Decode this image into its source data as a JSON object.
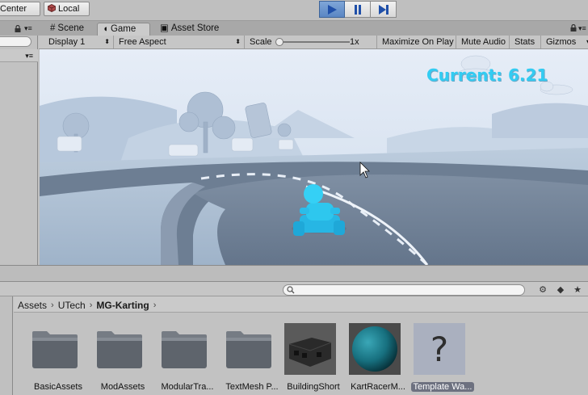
{
  "toolbar": {
    "center_label": "Center",
    "local_label": "Local"
  },
  "tabs": [
    {
      "label": "Scene",
      "icon": "grid-icon"
    },
    {
      "label": "Game",
      "icon": "pacman-icon"
    },
    {
      "label": "Asset Store",
      "icon": "store-icon"
    }
  ],
  "game_header": {
    "display": "Display 1",
    "aspect": "Free Aspect",
    "scale_label": "Scale",
    "scale_value": "1x",
    "maximize": "Maximize On Play",
    "mute": "Mute Audio",
    "stats": "Stats",
    "gizmos": "Gizmos"
  },
  "game": {
    "current_text": "Current: 6.21"
  },
  "breadcrumb": {
    "items": [
      "Assets",
      "UTech",
      "MG-Karting"
    ]
  },
  "assets": [
    {
      "label": "BasicAssets",
      "type": "folder"
    },
    {
      "label": "ModAssets",
      "type": "folder"
    },
    {
      "label": "ModularTra...",
      "type": "folder"
    },
    {
      "label": "TextMesh P...",
      "type": "folder"
    },
    {
      "label": "BuildingShort",
      "type": "prefab"
    },
    {
      "label": "KartRacerM...",
      "type": "material"
    },
    {
      "label": "Template Wa...",
      "type": "unknown"
    }
  ],
  "colors": {
    "accent_blue": "#33ccf2",
    "kart_cyan": "#2ec7ee",
    "play_active": "#5a86c3"
  }
}
